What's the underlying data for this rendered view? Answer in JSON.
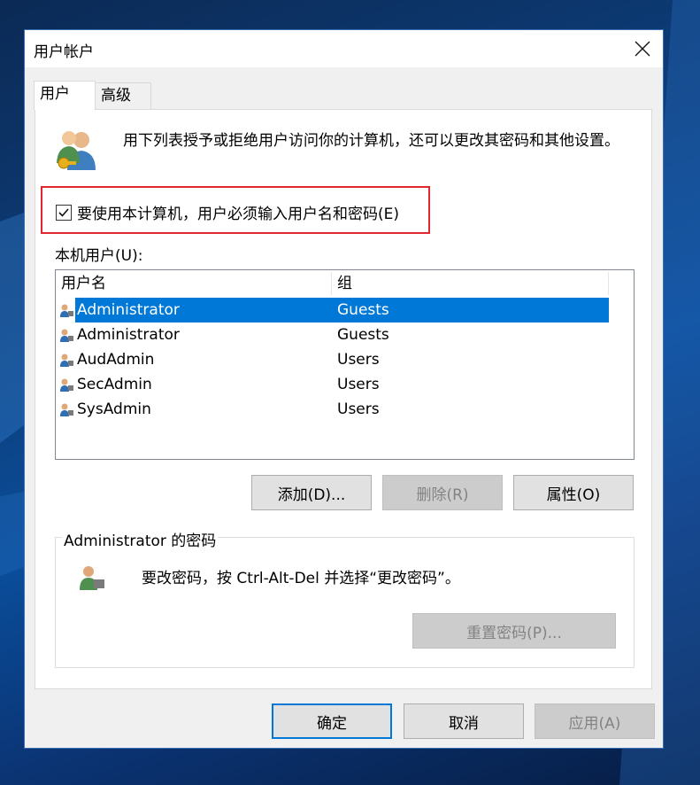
{
  "window": {
    "title": "用户帐户"
  },
  "tabs": [
    {
      "label": "用户"
    },
    {
      "label": "高级"
    }
  ],
  "description": "用下列表授予或拒绝用户访问你的计算机，还可以更改其密码和其他设置。",
  "require_login": {
    "label": "要使用本计算机，用户必须输入用户名和密码(E)",
    "checked": true
  },
  "local_users": {
    "label": "本机用户(U):",
    "columns": [
      "用户名",
      "组"
    ],
    "rows": [
      {
        "name": "Administrator",
        "group": "Guests",
        "selected": true
      },
      {
        "name": "Administrator",
        "group": "Guests",
        "selected": false
      },
      {
        "name": "AudAdmin",
        "group": "Users",
        "selected": false
      },
      {
        "name": "SecAdmin",
        "group": "Users",
        "selected": false
      },
      {
        "name": "SysAdmin",
        "group": "Users",
        "selected": false
      }
    ]
  },
  "user_buttons": {
    "add": "添加(D)...",
    "remove": "删除(R)",
    "properties": "属性(O)"
  },
  "password_group": {
    "title": "Administrator 的密码",
    "text": "要改密码，按 Ctrl-Alt-Del 并选择“更改密码”。",
    "reset_button": "重置密码(P)..."
  },
  "footer_buttons": {
    "ok": "确定",
    "cancel": "取消",
    "apply": "应用(A)"
  },
  "colors": {
    "selection": "#0078d7",
    "highlight_box": "#e0262e"
  }
}
